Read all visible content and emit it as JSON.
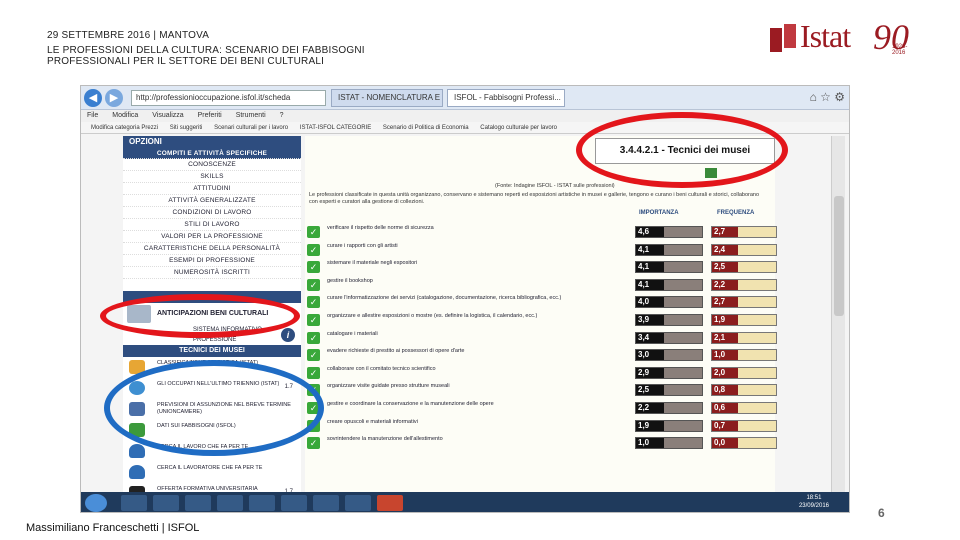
{
  "header": {
    "line1": "29 SETTEMBRE 2016 | MANTOVA",
    "line2": "LE PROFESSIONI DELLA CULTURA: SCENARIO DEI FABBISOGNI",
    "line3": "PROFESSIONALI PER IL SETTORE DEI BENI CULTURALI"
  },
  "logo": {
    "word": "Istat",
    "ninety": "90",
    "years": "1926-2016",
    "color": "#9b1b22"
  },
  "browser": {
    "address": "http://professionioccupazione.isfol.it/scheda",
    "tabs": [
      "ISTAT - NOMENCLATURA E C...",
      "ISFOL - Fabbisogni Professi..."
    ],
    "menu": [
      "File",
      "Modifica",
      "Visualizza",
      "Preferiti",
      "Strumenti",
      "?"
    ],
    "favorites": [
      "Modifica categoria Prezzi",
      "Siti suggeriti",
      "Scenari culturali per i lavoro",
      "ISTAT-ISFOL CATEGORIE",
      "Scenario di Politica di Economia",
      "Catalogo culturale per lavoro"
    ]
  },
  "left_panel": {
    "opzioni_title": "OPZIONI",
    "options": [
      "COMPITI E ATTIVITÀ SPECIFICHE",
      "CONOSCENZE",
      "SKILLS",
      "ATTITUDINI",
      "ATTIVITÀ GENERALIZZATE",
      "CONDIZIONI DI LAVORO",
      "STILI DI LAVORO",
      "VALORI PER LA PROFESSIONE",
      "CARATTERISTICHE DELLA PERSONALITÀ",
      "ESEMPI DI PROFESSIONE",
      "NUMEROSITÀ ISCRITTI"
    ],
    "anticipazioni": "ANTICIPAZIONI BENI CULTURALI",
    "sistema": "SISTEMA INFORMATIVO",
    "professione": "PROFESSIONE",
    "tecnici_head": "TECNICI DEI MUSEI",
    "links": [
      {
        "text": "CLASSIFICAZIONE STATISTICA (ISTAT)",
        "num": ""
      },
      {
        "text": "GLI OCCUPATI NELL'ULTIMO TRIENNIO (ISTAT)",
        "num": "1.7"
      },
      {
        "text": "PREVISIONI DI ASSUNZIONE NEL BREVE TERMINE (UNIONCAMERE)",
        "num": ""
      },
      {
        "text": "DATI SUI FABBISOGNI (ISFOL)",
        "num": ""
      },
      {
        "text": "CERCA IL LAVORO CHE FA PER TE",
        "num": ""
      },
      {
        "text": "CERCA IL LAVORATORE CHE FA PER TE",
        "num": ""
      },
      {
        "text": "OFFERTA FORMATIVA UNIVERSITARIA",
        "num": "1.7"
      }
    ]
  },
  "right_panel": {
    "title": "3.4.4.2.1 - Tecnici dei musei",
    "source": "(Fonte: Indagine ISFOL - ISTAT sulle professioni)",
    "description": "Le professioni classificate in questa unità organizzano, conservano e sistemano reperti ed esposizioni artistiche in musei e gallerie, tengono e curano i beni culturali e storici, collaborano con esperti e curatori alla gestione di collezioni.",
    "col_importanza": "IMPORTANZA",
    "col_frequenza": "FREQUENZA",
    "rows": [
      {
        "label": "verificare il rispetto delle norme di sicurezza",
        "imp": "4,6",
        "freq": "2,7"
      },
      {
        "label": "curare i rapporti con gli artisti",
        "imp": "4,1",
        "freq": "2,4"
      },
      {
        "label": "sistemare il materiale negli espositori",
        "imp": "4,1",
        "freq": "2,5"
      },
      {
        "label": "gestire il bookshop",
        "imp": "4,1",
        "freq": "2,2"
      },
      {
        "label": "curare l'informatizzazione dei servizi (catalogazione, documentazione, ricerca bibliografica, ecc.)",
        "imp": "4,0",
        "freq": "2,7"
      },
      {
        "label": "organizzare e allestire esposizioni o mostre (es. definire la logistica, il calendario, ecc.)",
        "imp": "3,9",
        "freq": "1,9"
      },
      {
        "label": "catalogare i materiali",
        "imp": "3,4",
        "freq": "2,1"
      },
      {
        "label": "evadere richieste di prestito ai possessori di opere d'arte",
        "imp": "3,0",
        "freq": "1,0"
      },
      {
        "label": "collaborare con il comitato tecnico scientifico",
        "imp": "2,9",
        "freq": "2,0"
      },
      {
        "label": "organizzare visite guidate presso strutture museali",
        "imp": "2,5",
        "freq": "0,8"
      },
      {
        "label": "gestire e coordinare la conservazione e la manutenzione delle opere",
        "imp": "2,2",
        "freq": "0,6"
      },
      {
        "label": "creare opuscoli e materiali informativi",
        "imp": "1,9",
        "freq": "0,7"
      },
      {
        "label": "sovrintendere la manutenzione dell'allestimento",
        "imp": "1,0",
        "freq": "0,0"
      }
    ]
  },
  "taskbar": {
    "clock_time": "18:51",
    "clock_date": "23/09/2016"
  },
  "footer": {
    "author": "Massimiliano Franceschetti | ISFOL",
    "page": "6"
  },
  "colors": {
    "annotation_red": "#e3161b",
    "annotation_blue": "#1f6cc4",
    "nav_blue": "#2e4d7f"
  }
}
